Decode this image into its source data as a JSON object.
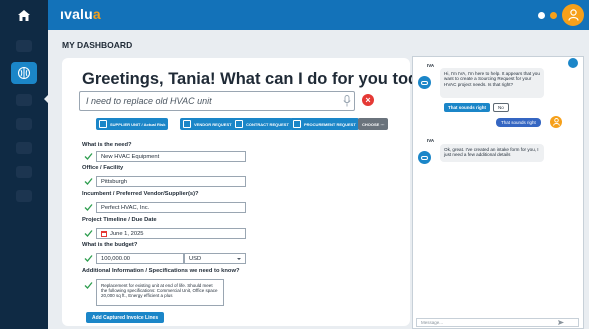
{
  "app": {
    "logo_main": "ıvalu",
    "logo_accent": "a"
  },
  "header": {
    "page_title": "MY DASHBOARD"
  },
  "greeting": "Greetings, Tania! What can I do for you today?",
  "prompt": {
    "value": "I need to replace old HVAC unit"
  },
  "chips": [
    {
      "label": "SUPPLIER UNIT / Actual Risk"
    },
    {
      "label": "VENDOR REQUEST"
    },
    {
      "label": "CONTRACT REQUEST"
    },
    {
      "label": "PROCUREMENT REQUEST"
    },
    {
      "label": "CHOOSE ⋯"
    }
  ],
  "form": {
    "need_label": "What is the need?",
    "need_value": "New HVAC Equipment",
    "office_label": "Office / Facility",
    "office_value": "Pittsburgh",
    "vendor_label": "Incumbent / Preferred Vendor/Supplier(s)?",
    "vendor_value": "Perfect HVAC, Inc.",
    "timeline_label": "Project Timeline / Due Date",
    "timeline_value": "June 1, 2025",
    "budget_label": "What is the budget?",
    "budget_value": "100,000.00",
    "currency": "USD",
    "info_label": "Additional Information / Specifications we need to know?",
    "info_value": "Replacement for existing unit at end of life. Should meet the following specifications: Commercial Unit, Office space 20,000 sq ft., Energy efficient a plus",
    "add_button": "Add Captured Invoice Lines"
  },
  "chat": {
    "sender_1": "IVA",
    "msg_1": "Hi, I'm IVA, I'm here to help. It appears that you want to create a Sourcing Request for your HVAC project needs. Is that right?",
    "reply_yes": "That sounds right",
    "reply_no": "No",
    "user_reply": "That sounds right",
    "sender_2": "IVA",
    "msg_2": "Ok, great. I've created an intake form for you, I just need a few additional details",
    "input_placeholder": "Message..."
  },
  "colors": {
    "brand_blue": "#1372b9",
    "accent_orange": "#f6a01a",
    "nav_dark": "#0f2a44",
    "alert_red": "#e53935"
  }
}
